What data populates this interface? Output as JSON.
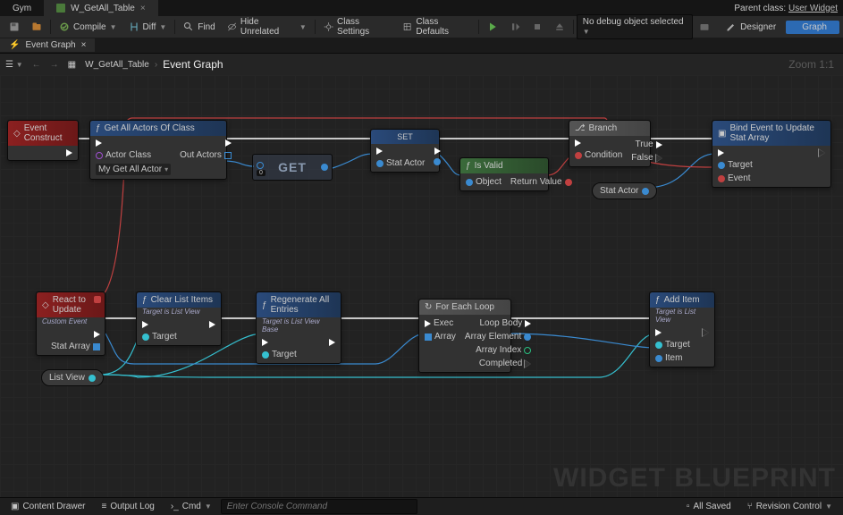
{
  "tabs": {
    "inactive": "Gym",
    "active": "W_GetAll_Table"
  },
  "parent_class": {
    "label": "Parent class:",
    "value": "User Widget"
  },
  "toolbar": {
    "compile": "Compile",
    "diff": "Diff",
    "find": "Find",
    "hide_unrelated": "Hide Unrelated",
    "class_settings": "Class Settings",
    "class_defaults": "Class Defaults",
    "debug_dropdown": "No debug object selected",
    "designer": "Designer",
    "graph": "Graph"
  },
  "subtab": "Event Graph",
  "breadcrumb": {
    "asset": "W_GetAll_Table",
    "graph": "Event Graph"
  },
  "zoom": "Zoom 1:1",
  "watermark": "WIDGET BLUEPRINT",
  "nodes": {
    "event_construct": {
      "title": "Event Construct"
    },
    "get_all_actors": {
      "title": "Get All Actors Of Class",
      "actor_class_label": "Actor Class",
      "actor_class_value": "My Get All Actor",
      "out_actors": "Out Actors"
    },
    "get": {
      "title": "GET",
      "index": "0"
    },
    "set": {
      "title": "SET",
      "var": "Stat Actor"
    },
    "is_valid": {
      "title": "Is Valid",
      "object": "Object",
      "return": "Return Value"
    },
    "branch": {
      "title": "Branch",
      "condition": "Condition",
      "true": "True",
      "false": "False"
    },
    "stat_actor_var": "Stat Actor",
    "bind_event": {
      "title": "Bind Event to Update Stat Array",
      "target": "Target",
      "event": "Event"
    },
    "react_update": {
      "title": "React to Update",
      "subtitle": "Custom Event",
      "stat_array": "Stat Array"
    },
    "clear_list": {
      "title": "Clear List Items",
      "subtitle": "Target is List View",
      "target": "Target"
    },
    "regen": {
      "title": "Regenerate All Entries",
      "subtitle": "Target is List View Base",
      "target": "Target"
    },
    "list_view_var": "List View",
    "foreach": {
      "title": "For Each Loop",
      "exec": "Exec",
      "array": "Array",
      "loop_body": "Loop Body",
      "array_element": "Array Element",
      "array_index": "Array Index",
      "completed": "Completed"
    },
    "add_item": {
      "title": "Add Item",
      "subtitle": "Target is List View",
      "target": "Target",
      "item": "Item"
    }
  },
  "bottombar": {
    "content_drawer": "Content Drawer",
    "output_log": "Output Log",
    "cmd_label": "Cmd",
    "cmd_placeholder": "Enter Console Command",
    "all_saved": "All Saved",
    "revision": "Revision Control"
  }
}
